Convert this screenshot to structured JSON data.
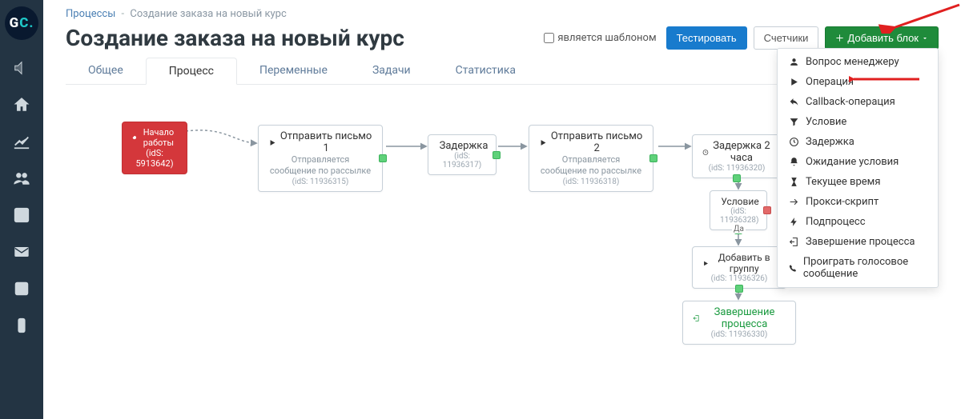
{
  "breadcrumb": {
    "root": "Процессы",
    "current": "Создание заказа на новый курс"
  },
  "page_title": "Создание заказа на новый курс",
  "header": {
    "template_checkbox_label": "является шаблоном",
    "test_button": "Тестировать",
    "counters_button": "Счетчики",
    "add_block_button": "Добавить блок"
  },
  "tabs": {
    "general": "Общее",
    "process": "Процесс",
    "variables": "Переменные",
    "tasks": "Задачи",
    "stats": "Статистика"
  },
  "nodes": {
    "start": {
      "title": "Начало работы",
      "ids": "(idS: 5913642)"
    },
    "mail1": {
      "title": "Отправить письмо 1",
      "sub": "Отправляется сообщение по рассылке",
      "ids": "(idS: 11936315)"
    },
    "delay1": {
      "title": "Задержка",
      "ids": "(idS: 11936317)"
    },
    "mail2": {
      "title": "Отправить письмо 2",
      "sub": "Отправляется сообщение по рассылке",
      "ids": "(idS: 11936318)"
    },
    "delay2": {
      "title": "Задержка 2 часа",
      "ids": "(idS: 11936320)"
    },
    "cond": {
      "title": "Условие",
      "ids": "(idS: 11936328)"
    },
    "cond_yes": "Да",
    "addgrp": {
      "title": "Добавить в группу",
      "ids": "(idS: 11936326)"
    },
    "end": {
      "title": "Завершение процесса",
      "ids": "(idS: 11936330)"
    }
  },
  "dropdown": {
    "items": [
      {
        "icon": "user",
        "label": "Вопрос менеджеру"
      },
      {
        "icon": "play",
        "label": "Операция"
      },
      {
        "icon": "reply",
        "label": "Callback-операция"
      },
      {
        "icon": "filter",
        "label": "Условие"
      },
      {
        "icon": "clock",
        "label": "Задержка"
      },
      {
        "icon": "bell",
        "label": "Ожидание условия"
      },
      {
        "icon": "hour",
        "label": "Текущее время"
      },
      {
        "icon": "arrow",
        "label": "Прокси-скрипт"
      },
      {
        "icon": "bolt",
        "label": "Подпроцесс"
      },
      {
        "icon": "exit",
        "label": "Завершение процесса"
      },
      {
        "icon": "phone",
        "label": "Проиграть голосовое сообщение"
      }
    ]
  }
}
